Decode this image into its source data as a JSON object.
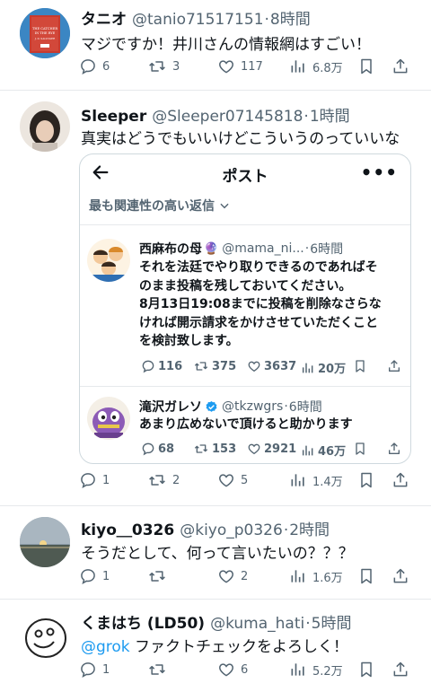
{
  "tweets": [
    {
      "name": "タニオ",
      "handle": "@tanio71517151",
      "time": "8時間",
      "text": "マジですか！井川さんの情報網はすごい！",
      "reply_count": "6",
      "retweet_count": "3",
      "like_count": "117",
      "view_count": "6.8万",
      "avatar_text": [
        "THE CATCHER",
        "IN THE RYE",
        "J. D. SALINGER"
      ]
    },
    {
      "name": "Sleeper",
      "handle": "@Sleeper07145818",
      "time": "1時間",
      "text": "真実はどうでもいいけどこういうのっていいな",
      "reply_count": "1",
      "retweet_count": "2",
      "like_count": "5",
      "view_count": "1.4万"
    },
    {
      "name": "kiyo＿0326",
      "handle": "@kiyo_p0326",
      "time": "2時間",
      "text": "そうだとして、何って言いたいの？？？",
      "reply_count": "1",
      "retweet_count": "",
      "like_count": "2",
      "view_count": "1.6万"
    },
    {
      "name": "くまはち (LD50)",
      "handle": "@kuma_hati",
      "time": "5時間",
      "mention": "@grok",
      "text": " ファクトチェックをよろしく！",
      "reply_count": "1",
      "retweet_count": "",
      "like_count": "6",
      "view_count": "5.2万"
    }
  ],
  "embed": {
    "title": "ポスト",
    "more": "•••",
    "sort_label": "最も関連性の高い返信",
    "replies": [
      {
        "name": "西麻布の母",
        "badge": "🔮",
        "handle": "@mama_ni...",
        "time": "6時間",
        "lines": [
          "それを法廷でやり取りできるのであればそ",
          "のまま投稿を残しておいてください。",
          "8月13日19:08までに投稿を削除なさらな",
          "ければ開示請求をかけさせていただくこと",
          "を検討致します。"
        ],
        "reply_count": "116",
        "retweet_count": "375",
        "like_count": "3637",
        "view_count": "20万"
      },
      {
        "name": "滝沢ガレソ",
        "handle": "@tkzwgrs",
        "time": "6時間",
        "lines": [
          "あまり広めないで頂けると助かります"
        ],
        "reply_count": "68",
        "retweet_count": "153",
        "like_count": "2921",
        "view_count": "46万"
      }
    ]
  },
  "time_separator": "·",
  "colors": {
    "text": "#0f1419",
    "muted": "#536471",
    "link": "#1d9bf0",
    "verified": "#1d9bf0",
    "divider": "#e6e9ec"
  },
  "icons": [
    "reply-icon",
    "retweet-icon",
    "like-icon",
    "views-icon",
    "bookmark-icon",
    "share-icon",
    "back-arrow-icon",
    "chevron-down-icon",
    "verified-icon"
  ]
}
